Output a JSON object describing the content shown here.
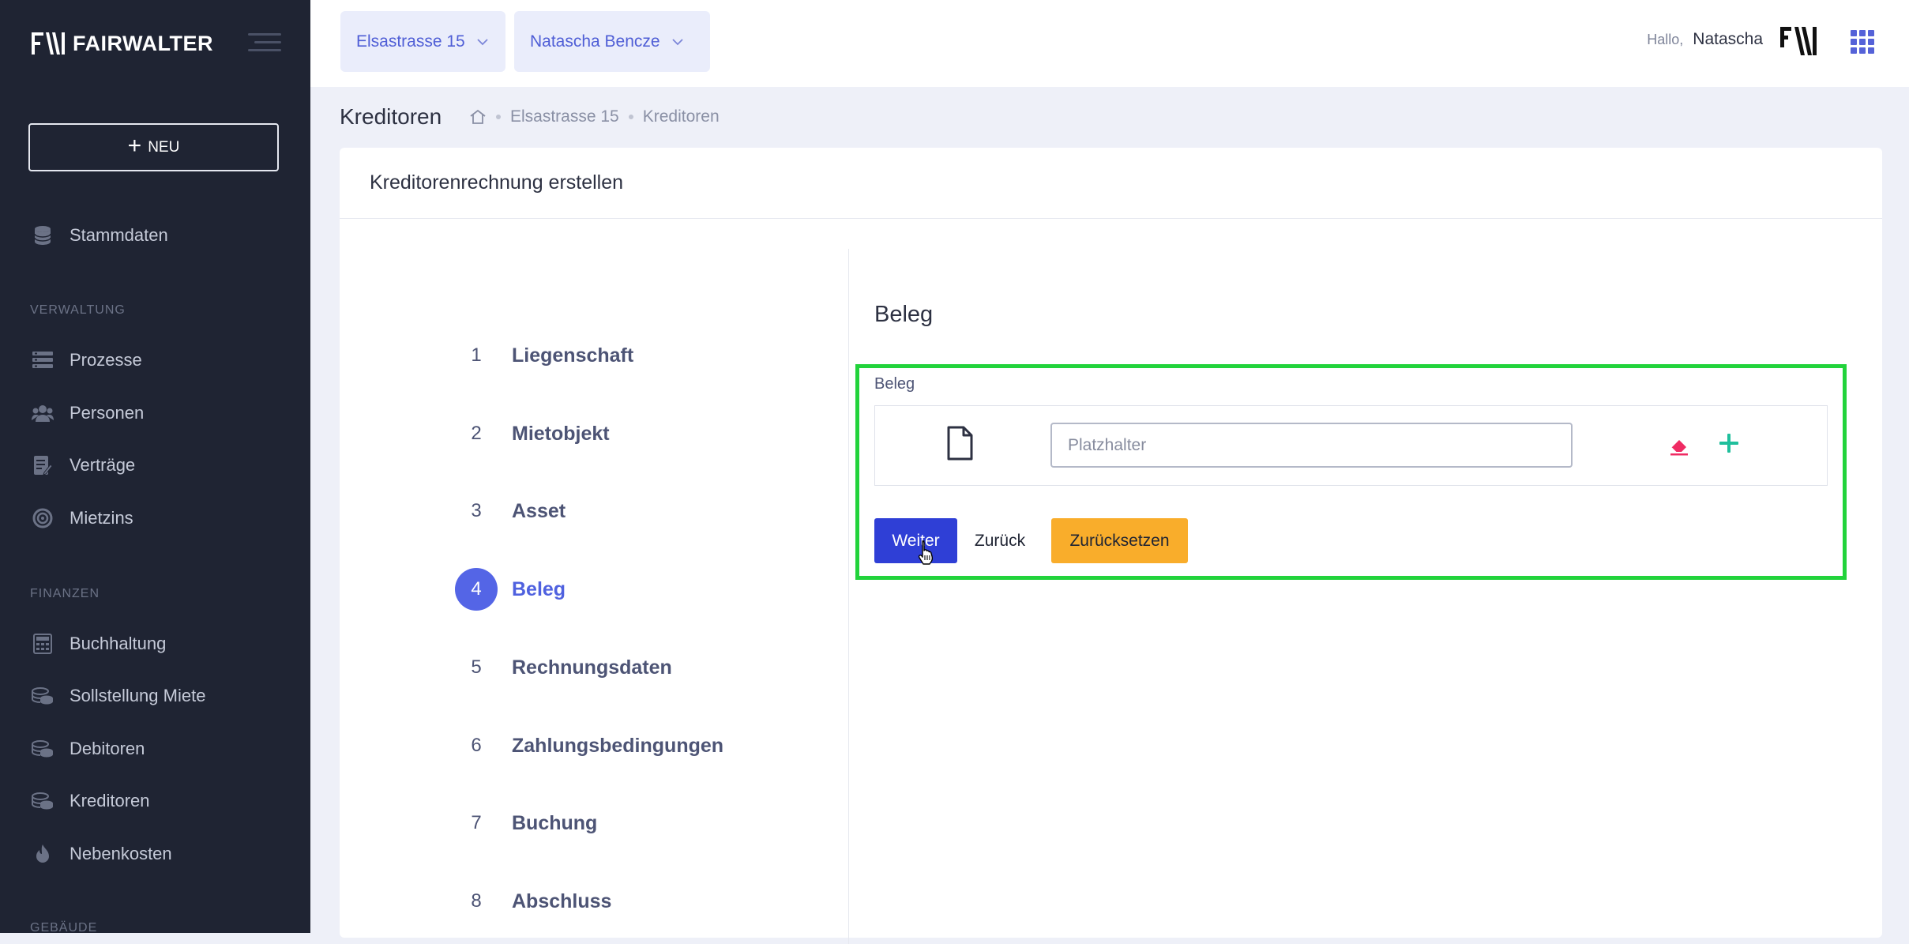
{
  "app": {
    "logo_text": "FAIRWALTER"
  },
  "sidebar": {
    "new_button_label": "NEU",
    "items": [
      {
        "label": "Stammdaten",
        "icon": "database-icon"
      },
      {
        "section": "VERWALTUNG"
      },
      {
        "label": "Prozesse",
        "icon": "process-icon"
      },
      {
        "label": "Personen",
        "icon": "people-icon"
      },
      {
        "label": "Verträge",
        "icon": "contract-icon"
      },
      {
        "label": "Mietzins",
        "icon": "rent-icon"
      },
      {
        "section": "FINANZEN"
      },
      {
        "label": "Buchhaltung",
        "icon": "calculator-icon"
      },
      {
        "label": "Sollstellung Miete",
        "icon": "coins-icon"
      },
      {
        "label": "Debitoren",
        "icon": "coins-icon"
      },
      {
        "label": "Kreditoren",
        "icon": "coins-icon"
      },
      {
        "label": "Nebenkosten",
        "icon": "flame-icon"
      },
      {
        "section": "GEBÄUDE"
      }
    ],
    "labels": {
      "stammdaten": "Stammdaten",
      "verwaltung": "VERWALTUNG",
      "prozesse": "Prozesse",
      "personen": "Personen",
      "vertraege": "Verträge",
      "mietzins": "Mietzins",
      "finanzen": "FINANZEN",
      "buchhaltung": "Buchhaltung",
      "sollstellung": "Sollstellung Miete",
      "debitoren": "Debitoren",
      "kreditoren": "Kreditoren",
      "nebenkosten": "Nebenkosten",
      "gebaeude": "GEBÄUDE"
    }
  },
  "header": {
    "property_dropdown": "Elsastrasse 15",
    "person_dropdown": "Natascha Bencze",
    "greeting": "Hallo,",
    "user_name": "Natascha",
    "accent_color": "#5562d8"
  },
  "breadcrumb": {
    "page_title": "Kreditoren",
    "path": [
      "Elsastrasse 15",
      "Kreditoren"
    ]
  },
  "card": {
    "title": "Kreditorenrechnung erstellen"
  },
  "stepper": {
    "active_step": 4,
    "steps": [
      {
        "num": "1",
        "label": "Liegenschaft"
      },
      {
        "num": "2",
        "label": "Mietobjekt"
      },
      {
        "num": "3",
        "label": "Asset"
      },
      {
        "num": "4",
        "label": "Beleg"
      },
      {
        "num": "5",
        "label": "Rechnungsdaten"
      },
      {
        "num": "6",
        "label": "Zahlungsbedingungen"
      },
      {
        "num": "7",
        "label": "Buchung"
      },
      {
        "num": "8",
        "label": "Abschluss"
      }
    ]
  },
  "form": {
    "section_title": "Beleg",
    "field_label": "Beleg",
    "file_input_value": "",
    "file_input_placeholder": "Platzhalter",
    "next_button": "Weiter",
    "back_button": "Zurück",
    "reset_button": "Zurücksetzen",
    "highlight_color": "#22d33b"
  }
}
